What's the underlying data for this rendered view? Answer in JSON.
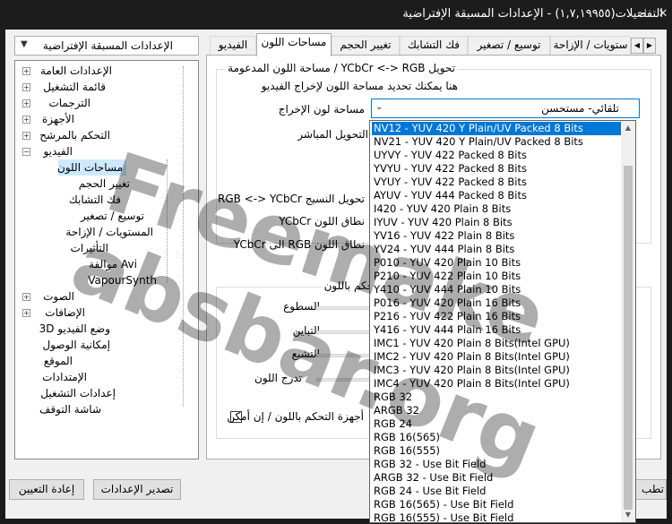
{
  "window": {
    "title": "التفضيلات(١,٧,١٩٩٥٥) - الإعدادات المسبقة الإفتراضية"
  },
  "left": {
    "preset": "الإعدادات المسبقة الإفتراضية",
    "tree": [
      {
        "label": "الإعدادات العامة",
        "expander": "+"
      },
      {
        "label": "قائمة التشغيل",
        "expander": "+"
      },
      {
        "label": "الترجمات",
        "expander": "+"
      },
      {
        "label": "الأجهزة",
        "expander": "+"
      },
      {
        "label": "التحكم بالمرشح",
        "expander": "+"
      },
      {
        "label": "الفيديو",
        "expander": "−"
      },
      {
        "label": "مساحات اللون"
      },
      {
        "label": "تغيير الحجم"
      },
      {
        "label": "فك التشابك"
      },
      {
        "label": "توسيع / تصغير"
      },
      {
        "label": "المستويات / الإزاحة"
      },
      {
        "label": "التأثيرات"
      },
      {
        "label": "Avi موالفة"
      },
      {
        "label": "VapourSynth"
      },
      {
        "label": "الصوت",
        "expander": "+"
      },
      {
        "label": "الإضافات",
        "expander": "+"
      },
      {
        "label": "وضع الفيديو 3D"
      },
      {
        "label": "إمكانية الوصول"
      },
      {
        "label": "الموقع"
      },
      {
        "label": "الإمتدادات"
      },
      {
        "label": "إعدادات التشغيل"
      },
      {
        "label": "شاشة التوقف"
      }
    ],
    "restore_button": "إعادة التعيين",
    "export_button": "تصدير الإعدادات"
  },
  "tabs": [
    "ستويات / الإزاحة",
    "توسيع / تصغير",
    "فك التشابك",
    "تغيير الحجم",
    "مساحات اللون",
    "الفيديو"
  ],
  "colorspace": {
    "group_title": "تحويل YCbCr <-> RGB / مساحة اللون المدعومة",
    "description": "هنا يمكنك تحديد مساحة اللون لإخراج الفيديو",
    "output_label": "مساحة لون الإخراج",
    "output_value": "تلقائي- مستحسن",
    "direct_label": "التحويل المباشر",
    "texture_label": "تحويل النسيج RGB <-> YCbCr",
    "ycbcr_range_label": "نطاق اللون YCbCr",
    "rgb_range_label": "نطاق اللون RGB الى YCbCr"
  },
  "color_control": {
    "group_title": "التحكم باللون",
    "brightness": "السطوع",
    "contrast": "التباين",
    "saturation": "التشبع",
    "hue": "تدرج اللون",
    "checkbox_label": "أجهزة التحكم باللون / إن أمكن"
  },
  "dropdown": {
    "items": [
      "NV12 - YUV 420 Y Plain/UV Packed 8 Bits",
      "NV21 - YUV 420 Y Plain/UV Packed 8 Bits",
      "UYVY - YUV 422 Packed 8 Bits",
      "YVYU - YUV 422 Packed 8 Bits",
      "VYUY - YUV 422 Packed 8 Bits",
      "AYUV - YUV 444 Packed 8 Bits",
      "I420 - YUV 420 Plain 8 Bits",
      "IYUV - YUV 420 Plain 8 Bits",
      "YV16 - YUV 422 Plain 8 Bits",
      "YV24 - YUV 444 Plain 8 Bits",
      "P010 - YUV 420 Plain 10 Bits",
      "P210 - YUV 422 Plain 10 Bits",
      "Y410 - YUV 444 Plain 10 Bits",
      "P016 - YUV 420 Plain 16 Bits",
      "P216 - YUV 422 Plain 16 Bits",
      "Y416 - YUV 444 Plain 16 Bits",
      "IMC1 - YUV 420 Plain 8 Bits(Intel GPU)",
      "IMC2 - YUV 420 Plain 8 Bits(Intel GPU)",
      "IMC3 - YUV 420 Plain 8 Bits(Intel GPU)",
      "IMC4 - YUV 420 Plain 8 Bits(Intel GPU)",
      "RGB 32",
      "ARGB 32",
      "RGB 24",
      "RGB 16(565)",
      "RGB 16(555)",
      "RGB 32 - Use Bit Field",
      "ARGB 32 - Use Bit Field",
      "RGB 24 - Use Bit Field",
      "RGB 16(565) - Use Bit Field",
      "RGB 16(555) - Use Bit Field"
    ]
  },
  "bottom": {
    "apply_partial": "تطب"
  },
  "watermark": {
    "line1": "Freemake",
    "line2": "absbar.org"
  }
}
